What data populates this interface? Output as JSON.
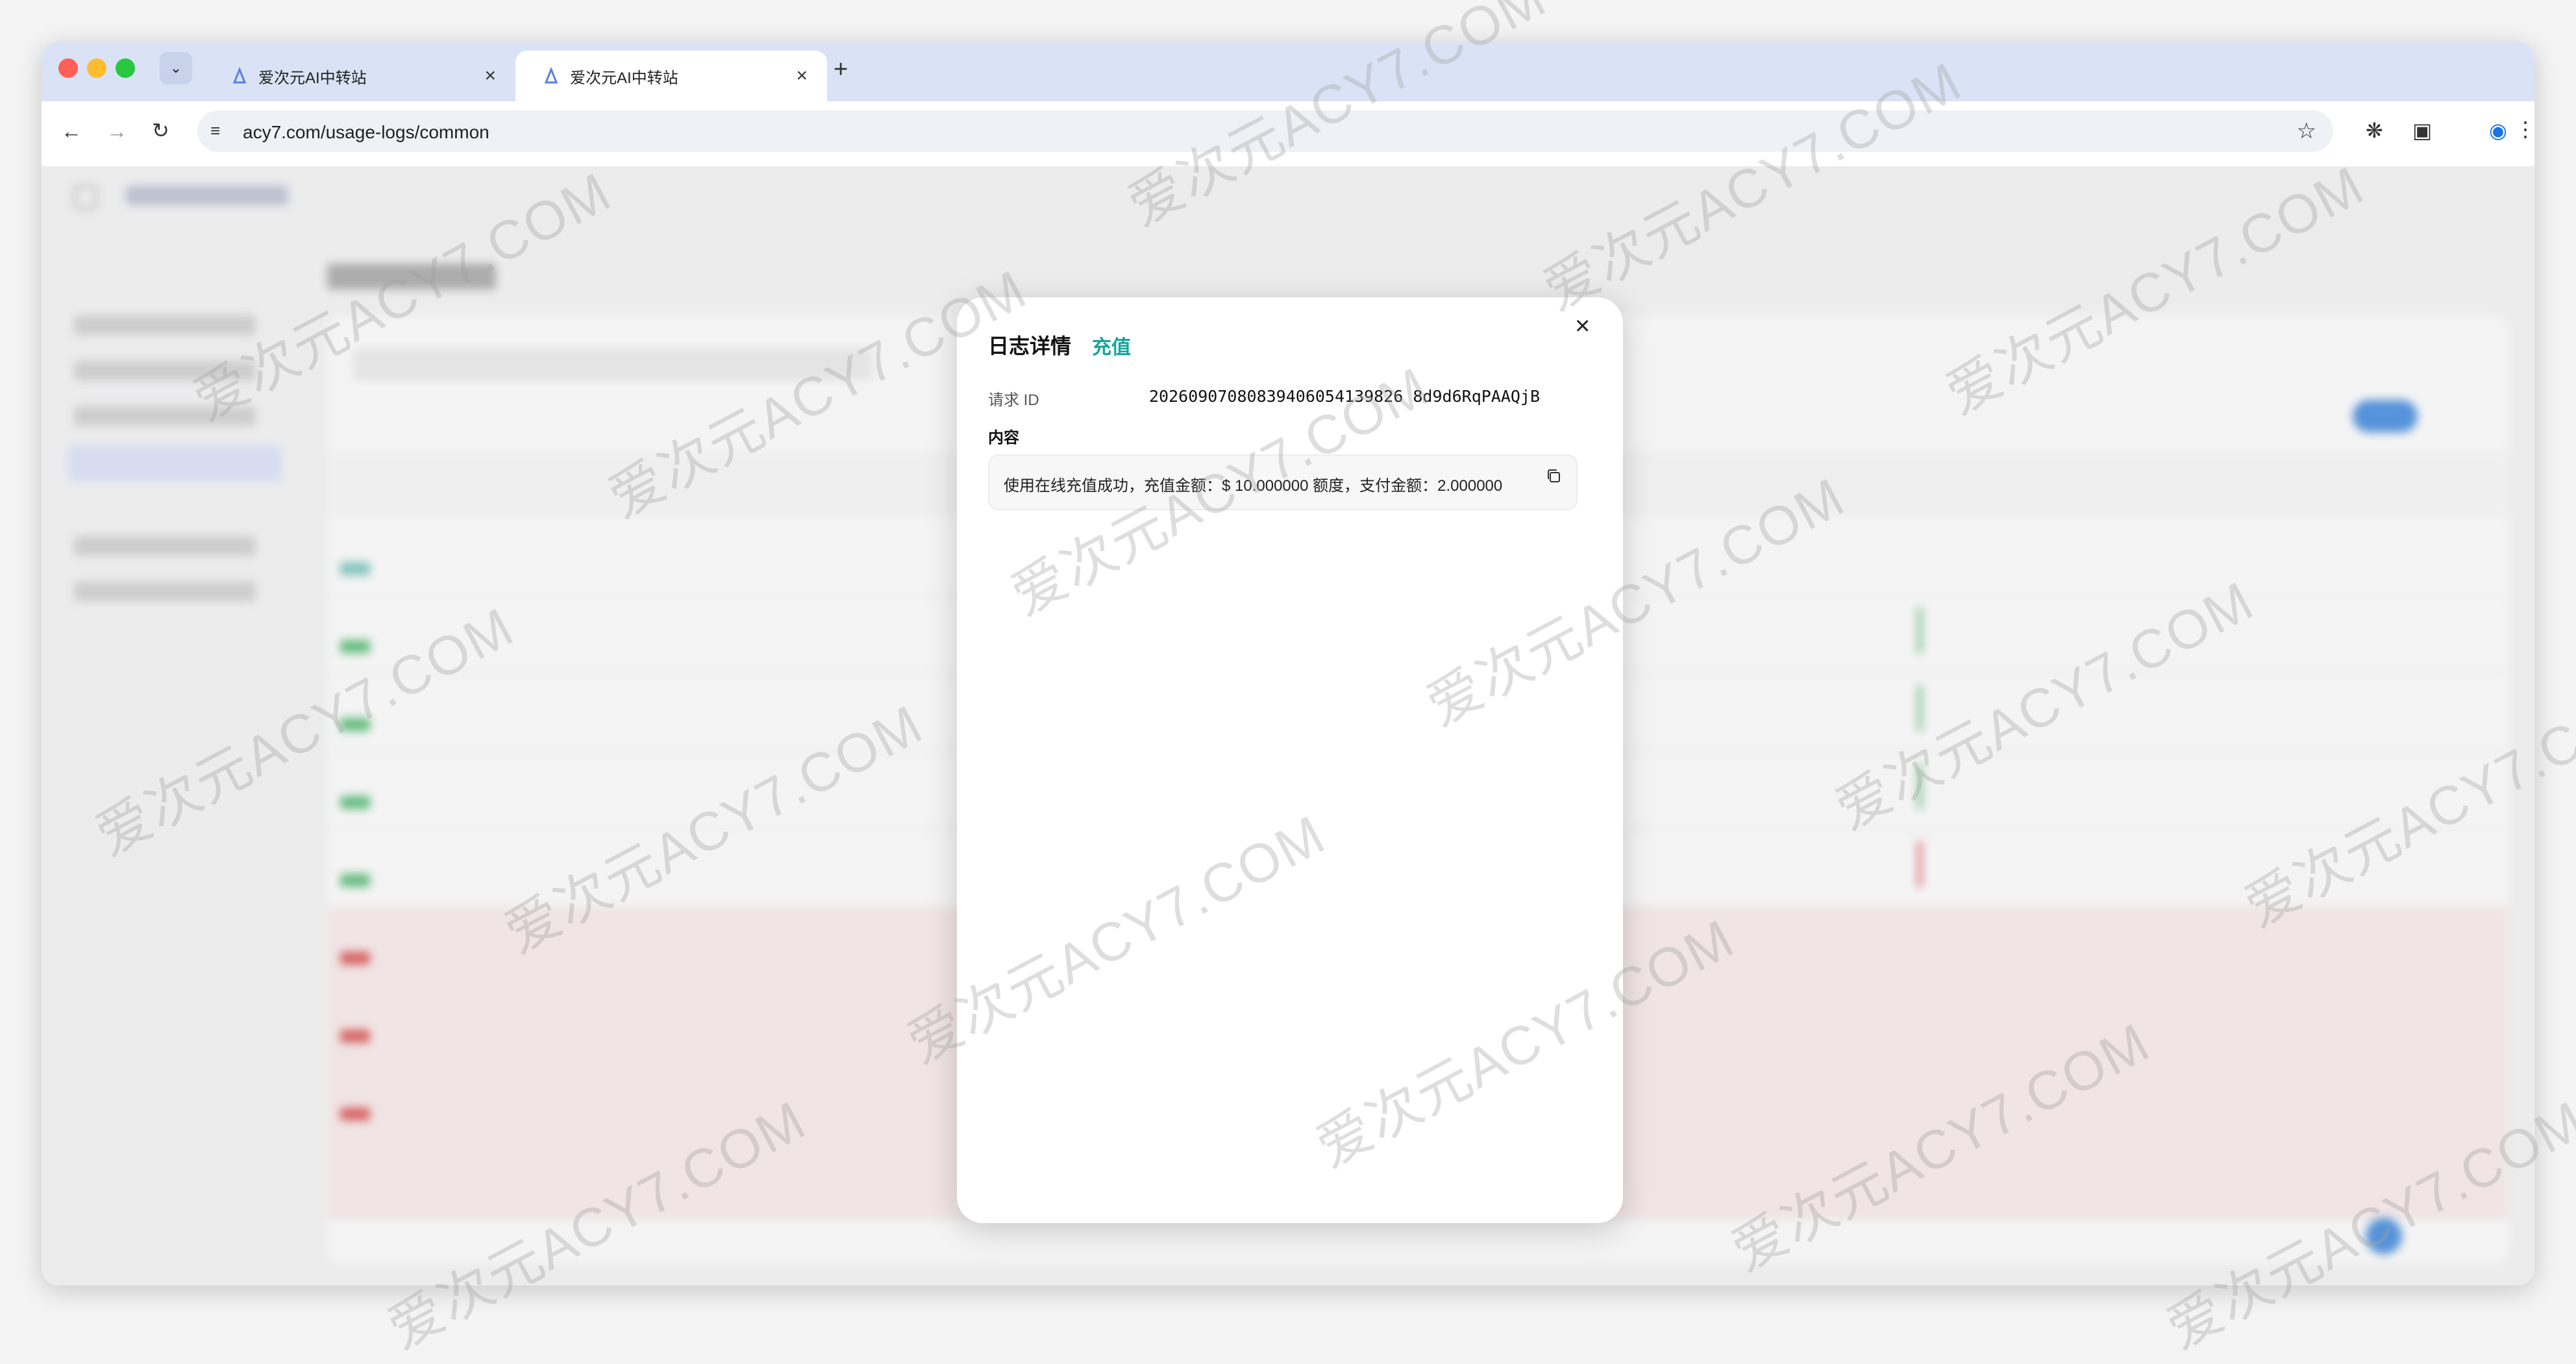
{
  "browser": {
    "tabs": [
      {
        "title": "爱次元AI中转站",
        "active": false
      },
      {
        "title": "爱次元AI中转站",
        "active": true
      }
    ],
    "new_tab": "+",
    "close_glyph": "×",
    "url": "acy7.com/usage-logs/common"
  },
  "modal": {
    "title": "日志详情",
    "type_badge": "充值",
    "request_id_label": "请求 ID",
    "request_id": "20260907080839406054139826 8d9d6RqPAAQjB",
    "content_label": "内容",
    "content_text": "使用在线充值成功，充值金额：$ 10.000000 额度，支付金额：2.000000",
    "close_glyph": "×"
  },
  "watermark": "爱次元ACY7.COM",
  "colors": {
    "accent": "#15a59a",
    "tabstrip": "#d9e3f5",
    "traffic_red": "#ff5f57",
    "traffic_yellow": "#febc2e",
    "traffic_green": "#28c840"
  }
}
